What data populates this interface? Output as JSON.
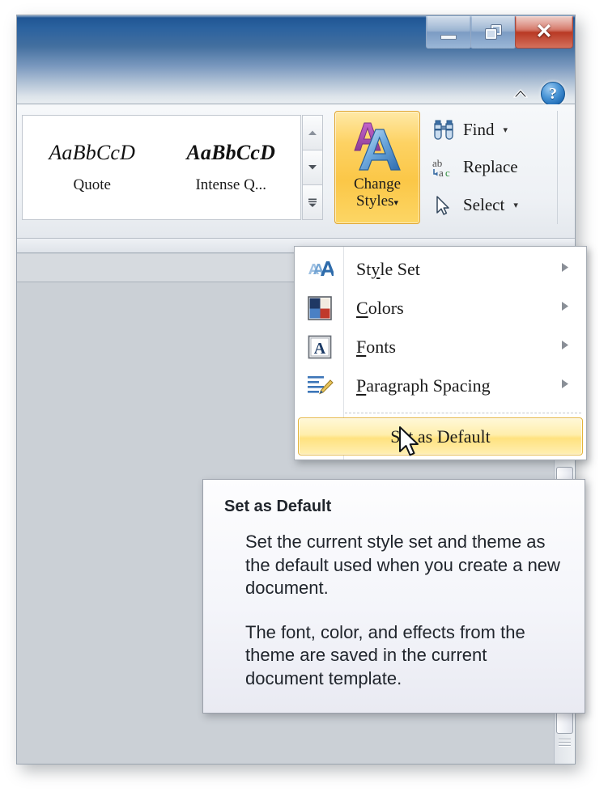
{
  "window": {
    "controls": {
      "minimize": "Minimize",
      "restore": "Restore Down",
      "close": "Close"
    },
    "collapse_ribbon": "Minimize the Ribbon",
    "help": "?"
  },
  "ribbon": {
    "styles_gallery": {
      "items": [
        {
          "sample": "AaBbCcD",
          "name": "Quote"
        },
        {
          "sample": "AaBbCcD",
          "name": "Intense Q..."
        }
      ],
      "scroll_up": "scroll-up-icon",
      "scroll_down": "scroll-down-icon",
      "more": "more-styles-icon"
    },
    "change_styles": {
      "line1": "Change",
      "line2": "Styles",
      "caret": "▾",
      "icon": "change-styles-icon"
    },
    "editing": [
      {
        "label": "Find",
        "caret": "▾",
        "icon": "binoculars-icon"
      },
      {
        "label": "Replace",
        "caret": "",
        "icon": "replace-ab-ac-icon"
      },
      {
        "label": "Select",
        "caret": "▾",
        "icon": "arrow-pointer-icon"
      }
    ]
  },
  "menu": {
    "items": [
      {
        "label_pre": "St",
        "label_accel": "y",
        "label_post": "le Set",
        "icon": "style-set-icon",
        "has_submenu": true
      },
      {
        "label_pre": "",
        "label_accel": "C",
        "label_post": "olors",
        "icon": "colors-swatch-icon",
        "has_submenu": true
      },
      {
        "label_pre": "",
        "label_accel": "F",
        "label_post": "onts",
        "icon": "fonts-a-icon",
        "has_submenu": true
      },
      {
        "label_pre": "",
        "label_accel": "P",
        "label_post": "aragraph Spacing",
        "icon": "paragraph-spacing-icon",
        "has_submenu": true
      }
    ],
    "default_item": {
      "label_pre": "S",
      "label_accel": "e",
      "label_post": "t as Default"
    }
  },
  "tooltip": {
    "title": "Set as Default",
    "paragraphs": [
      "Set the current style set and theme as the default used when you create a new document.",
      "The font, color, and effects from the theme are saved in the current document template."
    ]
  },
  "colors": {
    "titlebar_top": "#1d5291",
    "titlebar_bottom": "#e9edf1",
    "accent_highlight": "#ffe27f",
    "close_button": "#b93a25",
    "document_background": "#cbd0d6",
    "menu_background": "#ffffff"
  }
}
